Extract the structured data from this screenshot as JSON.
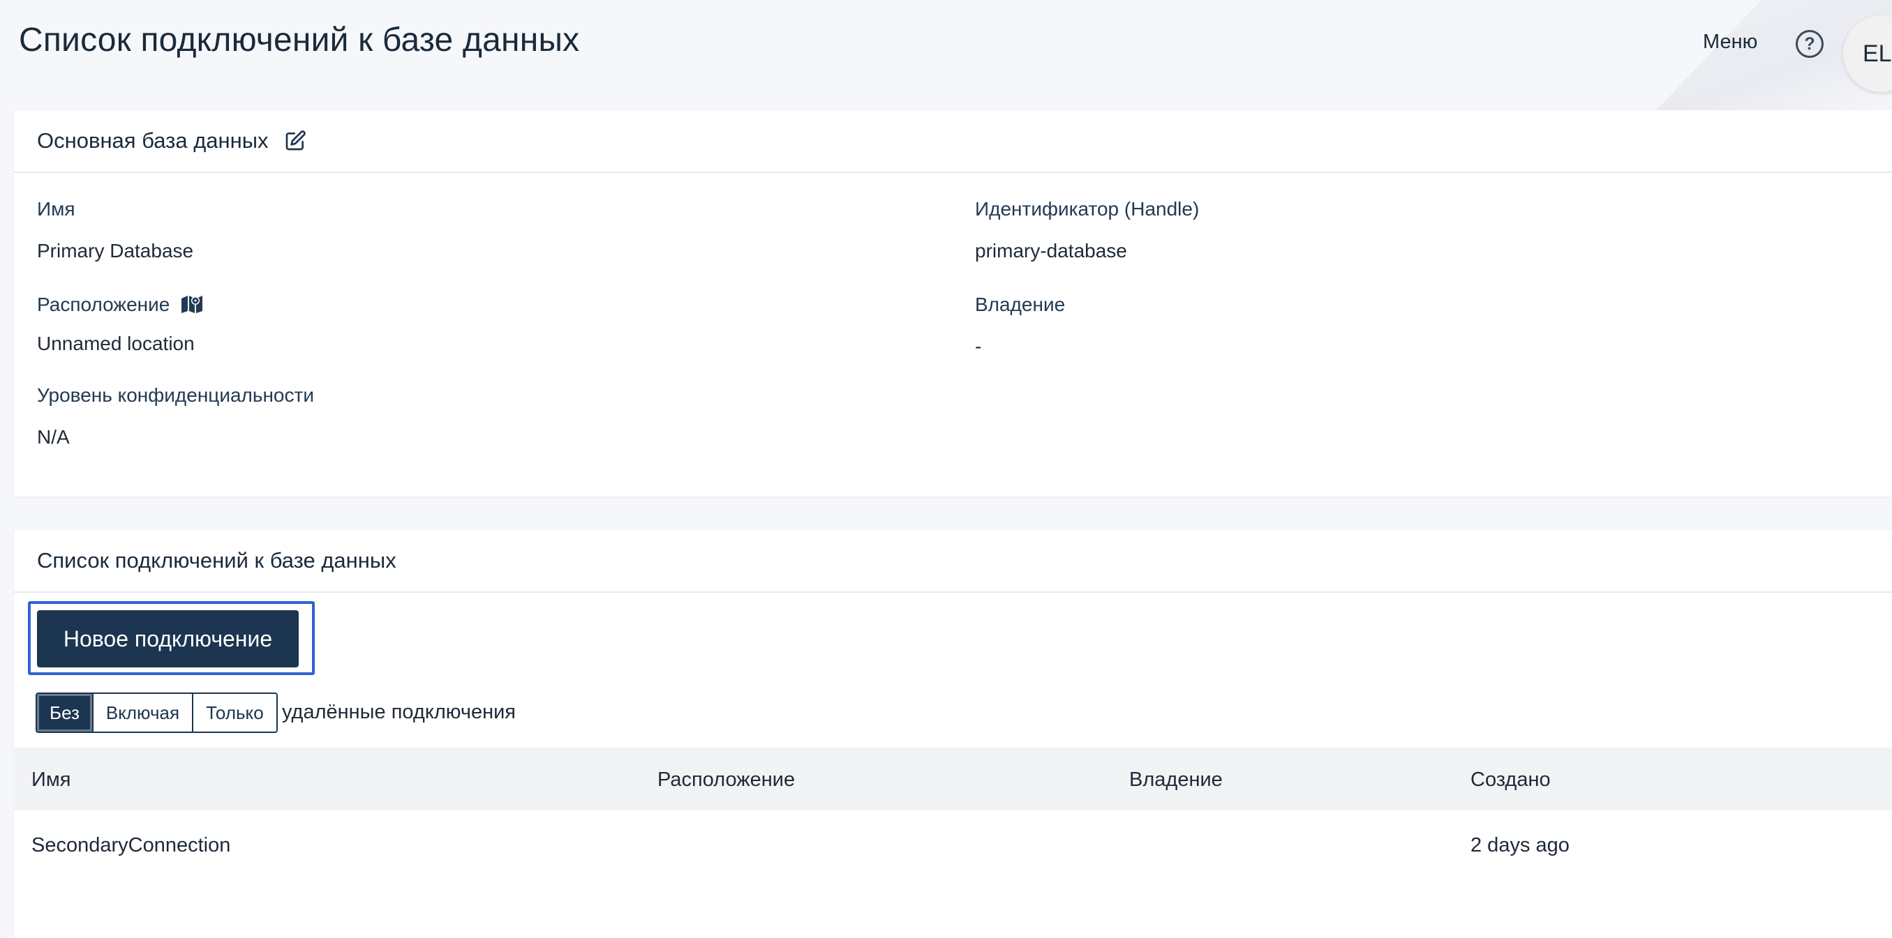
{
  "header": {
    "title": "Список подключений к базе данных",
    "menu_label": "Меню",
    "help_symbol": "?",
    "avatar_initials": "EL"
  },
  "database_card": {
    "title": "Основная база данных",
    "edit_icon": "edit-icon",
    "fields": {
      "name_label": "Имя",
      "name_value": "Primary Database",
      "handle_label": "Идентификатор (Handle)",
      "handle_value": "primary-database",
      "location_label": "Расположение",
      "location_icon": "map-icon",
      "location_value": "Unnamed location",
      "ownership_label": "Владение",
      "ownership_value": "-",
      "confidentiality_label": "Уровень конфиденциальности",
      "confidentiality_value": "N/A"
    }
  },
  "connections_card": {
    "title": "Список подключений к базе данных",
    "new_connection_label": "Новое подключение",
    "filter": {
      "options": [
        "Без",
        "Включая",
        "Только"
      ],
      "selected": "Без",
      "suffix": "удалённые подключения"
    },
    "table": {
      "columns": [
        "Имя",
        "Расположение",
        "Владение",
        "Создано"
      ],
      "rows": [
        {
          "name": "SecondaryConnection",
          "location": "",
          "ownership": "",
          "created": "2 days ago"
        }
      ]
    }
  },
  "colors": {
    "primary": "#1c3550",
    "focus_outline": "#2f62d8",
    "background": "#f6f7fa"
  }
}
